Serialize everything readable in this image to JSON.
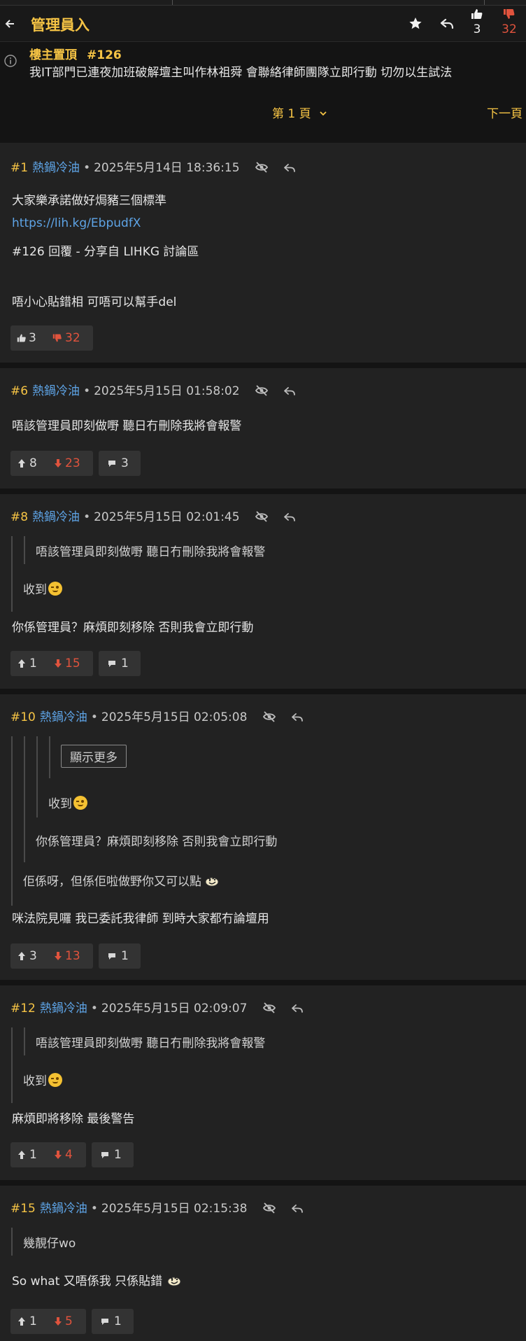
{
  "header": {
    "title": "管理員入",
    "upvotes": "3",
    "downvotes": "32"
  },
  "pinned": {
    "label": "樓主置頂",
    "ref": "#126",
    "text": "我IT部門已連夜加班破解壇主叫作林祖舜 會聯絡律師團隊立即行動 切勿以生試法",
    "page_label": "第 1 頁",
    "next_label": "下一頁"
  },
  "posts": [
    {
      "num": "#1",
      "user": "熱鍋冷油",
      "time": "2025年5月14日 18:36:15",
      "lines": [
        "大家樂承諾做好焗豬三個標準",
        "https://lih.kg/EbpudfX",
        "#126 回覆 - 分享自 LIHKG 討論區",
        "唔小心貼錯相 可唔可以幫手del"
      ],
      "up": "3",
      "down": "32"
    },
    {
      "num": "#6",
      "user": "熱鍋冷油",
      "time": "2025年5月15日 01:58:02",
      "lines": [
        "唔該管理員即刻做嘢 聽日冇刪除我將會報警"
      ],
      "up": "8",
      "down": "23",
      "replies": "3"
    },
    {
      "num": "#8",
      "user": "熱鍋冷油",
      "time": "2025年5月15日 02:01:45",
      "quote": [
        "唔該管理員即刻做嘢 聽日冇刪除我將會報警",
        "收到"
      ],
      "lines": [
        "你係管理員？麻煩即刻移除 否則我會立即行動"
      ],
      "up": "1",
      "down": "15",
      "replies": "1"
    },
    {
      "num": "#10",
      "user": "熱鍋冷油",
      "time": "2025年5月15日 02:05:08",
      "showmore": "顯示更多",
      "quote": [
        "收到",
        "你係管理員？麻煩即刻移除 否則我會立即行動",
        "佢係呀，但係佢啦做野你又可以點"
      ],
      "lines": [
        "咪法院見囉 我已委託我律師 到時大家都冇論壇用"
      ],
      "up": "3",
      "down": "13",
      "replies": "1"
    },
    {
      "num": "#12",
      "user": "熱鍋冷油",
      "time": "2025年5月15日 02:09:07",
      "quote": [
        "唔該管理員即刻做嘢 聽日冇刪除我將會報警",
        "收到"
      ],
      "lines": [
        "麻煩即將移除 最後警告"
      ],
      "up": "1",
      "down": "4",
      "replies": "1"
    },
    {
      "num": "#15",
      "user": "熱鍋冷油",
      "time": "2025年5月15日 02:15:38",
      "quote": [
        "幾靚仔wo"
      ],
      "lines": [
        "So what 又唔係我 只係貼錯"
      ],
      "up": "1",
      "down": "5",
      "replies": "1"
    }
  ],
  "colors": {
    "accent": "#f6c445",
    "user": "#5ea4e6",
    "downvote": "#e0533d",
    "post_bg": "#222222",
    "page_bg": "#141414"
  }
}
